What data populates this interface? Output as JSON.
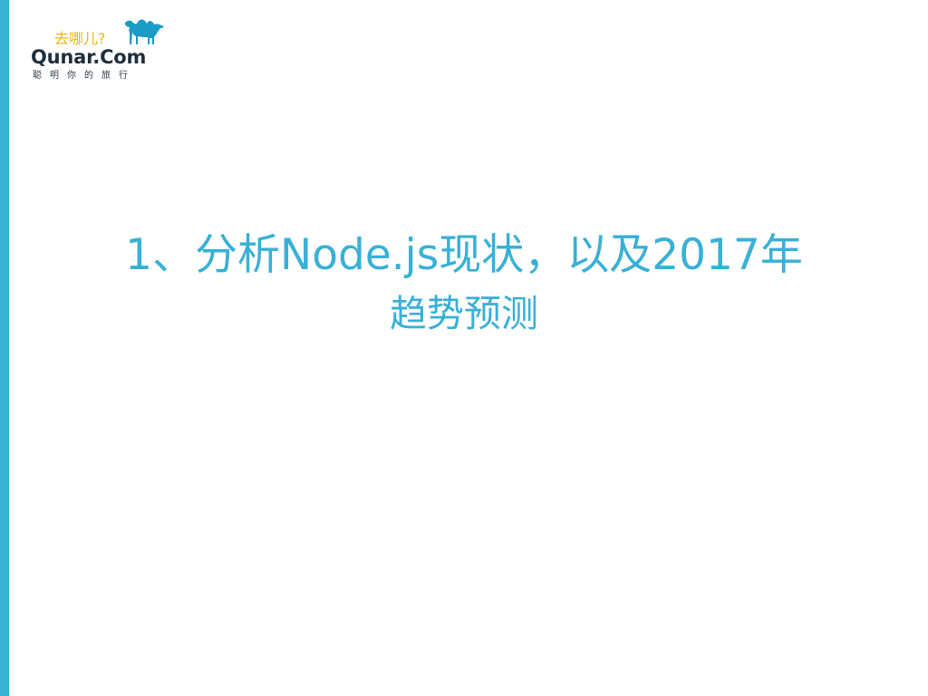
{
  "slide": {
    "accent_color": "#39b0d6",
    "title_line_1": "1、分析Node.js现状，以及2017年",
    "title_line_2": "趋势预测"
  },
  "logo": {
    "slogan_cn": "去哪儿?",
    "wordmark": "Qunar.Com",
    "tagline": "聪明你的旅行",
    "camel_icon": "camel-icon",
    "slogan_color": "#f0b21a",
    "camel_color": "#1b9cc7",
    "wordmark_color": "#1f2f3d"
  }
}
